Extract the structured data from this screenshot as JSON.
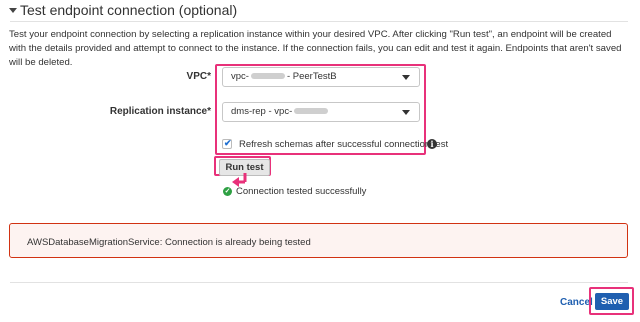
{
  "section": {
    "title": "Test endpoint connection (optional)",
    "description": "Test your endpoint connection by selecting a replication instance within your desired VPC. After clicking \"Run test\", an endpoint will be created with the details provided and attempt to connect to the instance. If the connection fails, you can edit and test it again. Endpoints that aren't saved will be deleted."
  },
  "vpc": {
    "label": "VPC*",
    "value_prefix": "vpc-",
    "value_suffix": "- PeerTestB",
    "dropdown_icon": "caret-down-icon"
  },
  "replication_instance": {
    "label": "Replication instance*",
    "value_prefix": "dms-rep - vpc-",
    "dropdown_icon": "caret-down-icon"
  },
  "refresh_schemas": {
    "label": "Refresh schemas after successful connection test",
    "checked": true,
    "info_icon": "info-icon"
  },
  "run_test": {
    "label": "Run test"
  },
  "status": {
    "text": "Connection tested successfully",
    "icon": "check-circle-icon",
    "color": "#2ea043"
  },
  "error": {
    "text": "AWSDatabaseMigrationService: Connection is already being tested",
    "border_color": "#d13212"
  },
  "footer": {
    "cancel_label": "Cancel",
    "save_label": "Save",
    "primary_color": "#1f5fb0",
    "highlight_color": "#e8317a"
  }
}
